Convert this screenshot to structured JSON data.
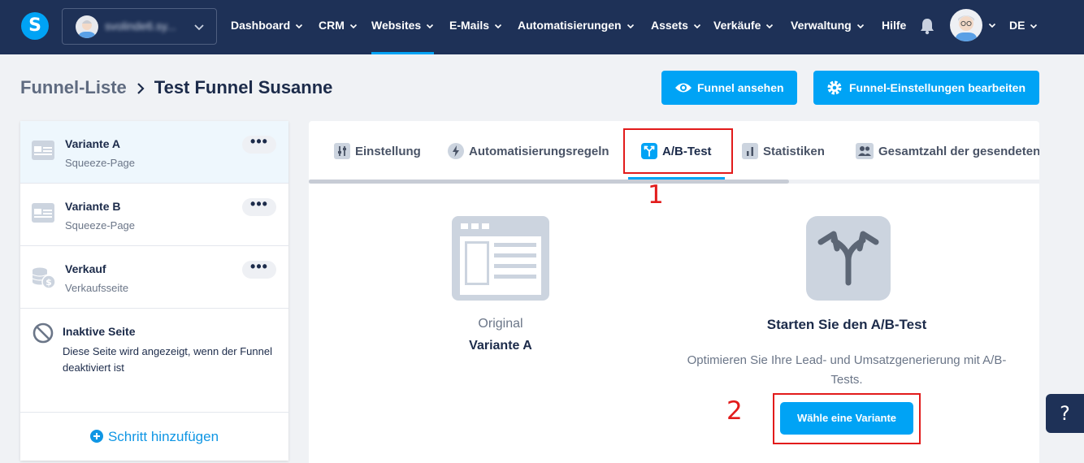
{
  "nav": {
    "logo_letter": "S",
    "account_name": "svolinde6.sy...",
    "items": [
      {
        "label": "Dashboard"
      },
      {
        "label": "CRM"
      },
      {
        "label": "Websites"
      },
      {
        "label": "E-Mails"
      },
      {
        "label": "Automatisierungen"
      },
      {
        "label": "Assets"
      },
      {
        "label": "Verkäufe"
      },
      {
        "label": "Verwaltung"
      }
    ],
    "help_label": "Hilfe",
    "language": "DE",
    "active_item": "Websites"
  },
  "header": {
    "breadcrumb_parent": "Funnel-Liste",
    "breadcrumb_current": "Test Funnel Susanne",
    "view_button": "Funnel ansehen",
    "settings_button": "Funnel-Einstellungen bearbeiten"
  },
  "sidebar": {
    "steps": [
      {
        "title": "Variante A",
        "subtitle": "Squeeze-Page",
        "icon": "page-layout-icon",
        "selected": true
      },
      {
        "title": "Variante B",
        "subtitle": "Squeeze-Page",
        "icon": "page-layout-icon",
        "selected": false
      },
      {
        "title": "Verkauf",
        "subtitle": "Verkaufsseite",
        "icon": "coins-icon",
        "selected": false
      }
    ],
    "more_label": "•••",
    "inactive": {
      "title": "Inaktive Seite",
      "description": "Diese Seite wird angezeigt, wenn der Funnel deaktiviert ist"
    },
    "add_step": "Schritt hinzufügen"
  },
  "tabs": {
    "items": [
      {
        "label": "Einstellung",
        "icon": "sliders-icon"
      },
      {
        "label": "Automatisierungsregeln",
        "icon": "lightning-icon"
      },
      {
        "label": "A/B-Test",
        "icon": "split-icon"
      },
      {
        "label": "Statistiken",
        "icon": "bar-chart-icon"
      },
      {
        "label": "Gesamtzahl der gesendeten",
        "icon": "users-icon"
      }
    ],
    "active": "A/B-Test"
  },
  "abtest": {
    "original_label": "Original",
    "original_variant": "Variante A",
    "title": "Starten Sie den A/B-Test",
    "description": "Optimieren Sie Ihre Lead- und Umsatzgenerierung mit A/B-Tests.",
    "choose_button": "Wähle eine Variante"
  },
  "annotations": {
    "marker_1": "1",
    "marker_2": "2",
    "color": "#e21b1b"
  },
  "help_button": "?",
  "colors": {
    "nav_bg": "#1e3157",
    "accent": "#00a3f5",
    "page_bg": "#f0f2f5"
  }
}
